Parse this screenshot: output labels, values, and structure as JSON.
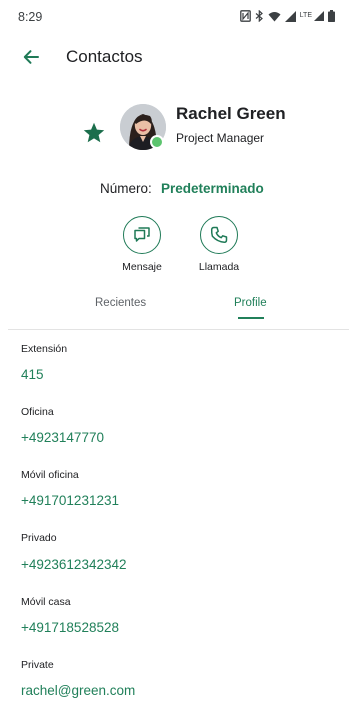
{
  "status_bar": {
    "time": "8:29",
    "lte": "LTE"
  },
  "app_bar": {
    "title": "Contactos"
  },
  "contact": {
    "name": "Rachel Green",
    "role": "Project Manager",
    "favorite": true,
    "presence": "available"
  },
  "number": {
    "label": "Número:",
    "value": "Predeterminado"
  },
  "actions": [
    {
      "label": "Mensaje",
      "icon": "message-icon"
    },
    {
      "label": "Llamada",
      "icon": "phone-icon"
    }
  ],
  "tabs": [
    {
      "label": "Recientes",
      "selected": false
    },
    {
      "label": "Profile",
      "selected": true
    }
  ],
  "fields": [
    {
      "label": "Extensión",
      "value": "415"
    },
    {
      "label": "Oficina",
      "value": "+4923147770"
    },
    {
      "label": "Móvil oficina",
      "value": "+491701231231"
    },
    {
      "label": "Privado",
      "value": "+4923612342342"
    },
    {
      "label": "Móvil casa",
      "value": "+491718528528"
    },
    {
      "label": "Private",
      "value": "rachel@green.com"
    }
  ],
  "colors": {
    "accent": "#21805a",
    "star": "#1b6e4c",
    "presence": "#5cc46e",
    "divider": "#e3e3e3"
  }
}
